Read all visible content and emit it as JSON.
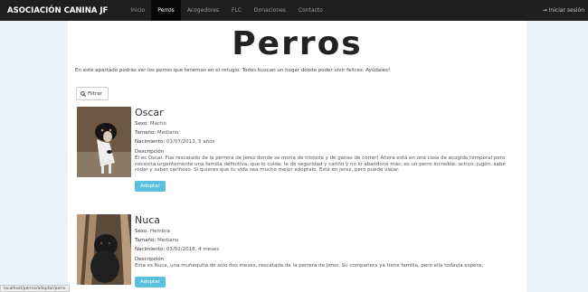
{
  "nav": {
    "brand": "ASOCIACIÓN CANINA JF",
    "items": [
      {
        "label": "Inicio"
      },
      {
        "label": "Perros"
      },
      {
        "label": "Acogedores"
      },
      {
        "label": "FLC"
      },
      {
        "label": "Donaciones"
      },
      {
        "label": "Contacto"
      }
    ],
    "login": "Iniciar sesión"
  },
  "page": {
    "title": "Perros",
    "intro": "En este apartado podrás ver los perros que tenemos en el refugio. Todos buscan un hogar donde poder vivir felices. Ayúdales!",
    "filter_label": "Filtrar"
  },
  "labels": {
    "sexo": "Sexo:",
    "tamano": "Tamaño:",
    "nacimiento": "Nacimiento:",
    "descripcion": "Descripción",
    "adopt": "Adoptar"
  },
  "dogs": [
    {
      "name": "Oscar",
      "sexo": "Macho",
      "tamano": "Mediano",
      "nacimiento": "01/07/2013, 5 años",
      "descripcion": "Él es Oscar. Fue rescatado de la perrera de Jerez donde se moría de tristeza y de ganas de correr! Ahora está en una casa de acogida temporal pero necesita urgentemente una familia definitiva, que lo cuide, le de seguridad y cariño y no lo abandone más, es un perro increíble: activo, jugón, sabe rodar y saber cariñoso. Sí quieres que tu vida sea mucho mejor adóptalo. Está en Jerez, pero puede viajar."
    },
    {
      "name": "Nuca",
      "sexo": "Hembra",
      "tamano": "Mediano",
      "nacimiento": "03/02/2018, 4 meses",
      "descripcion": "Esta es Nuca, una muñequita de solo dos meses, rescatada de la perrera de Jerez. Su compañera ya tiene familia, pero ella todavía espera."
    }
  ],
  "status_bar": "localhost/perros/adoptar/perro"
}
